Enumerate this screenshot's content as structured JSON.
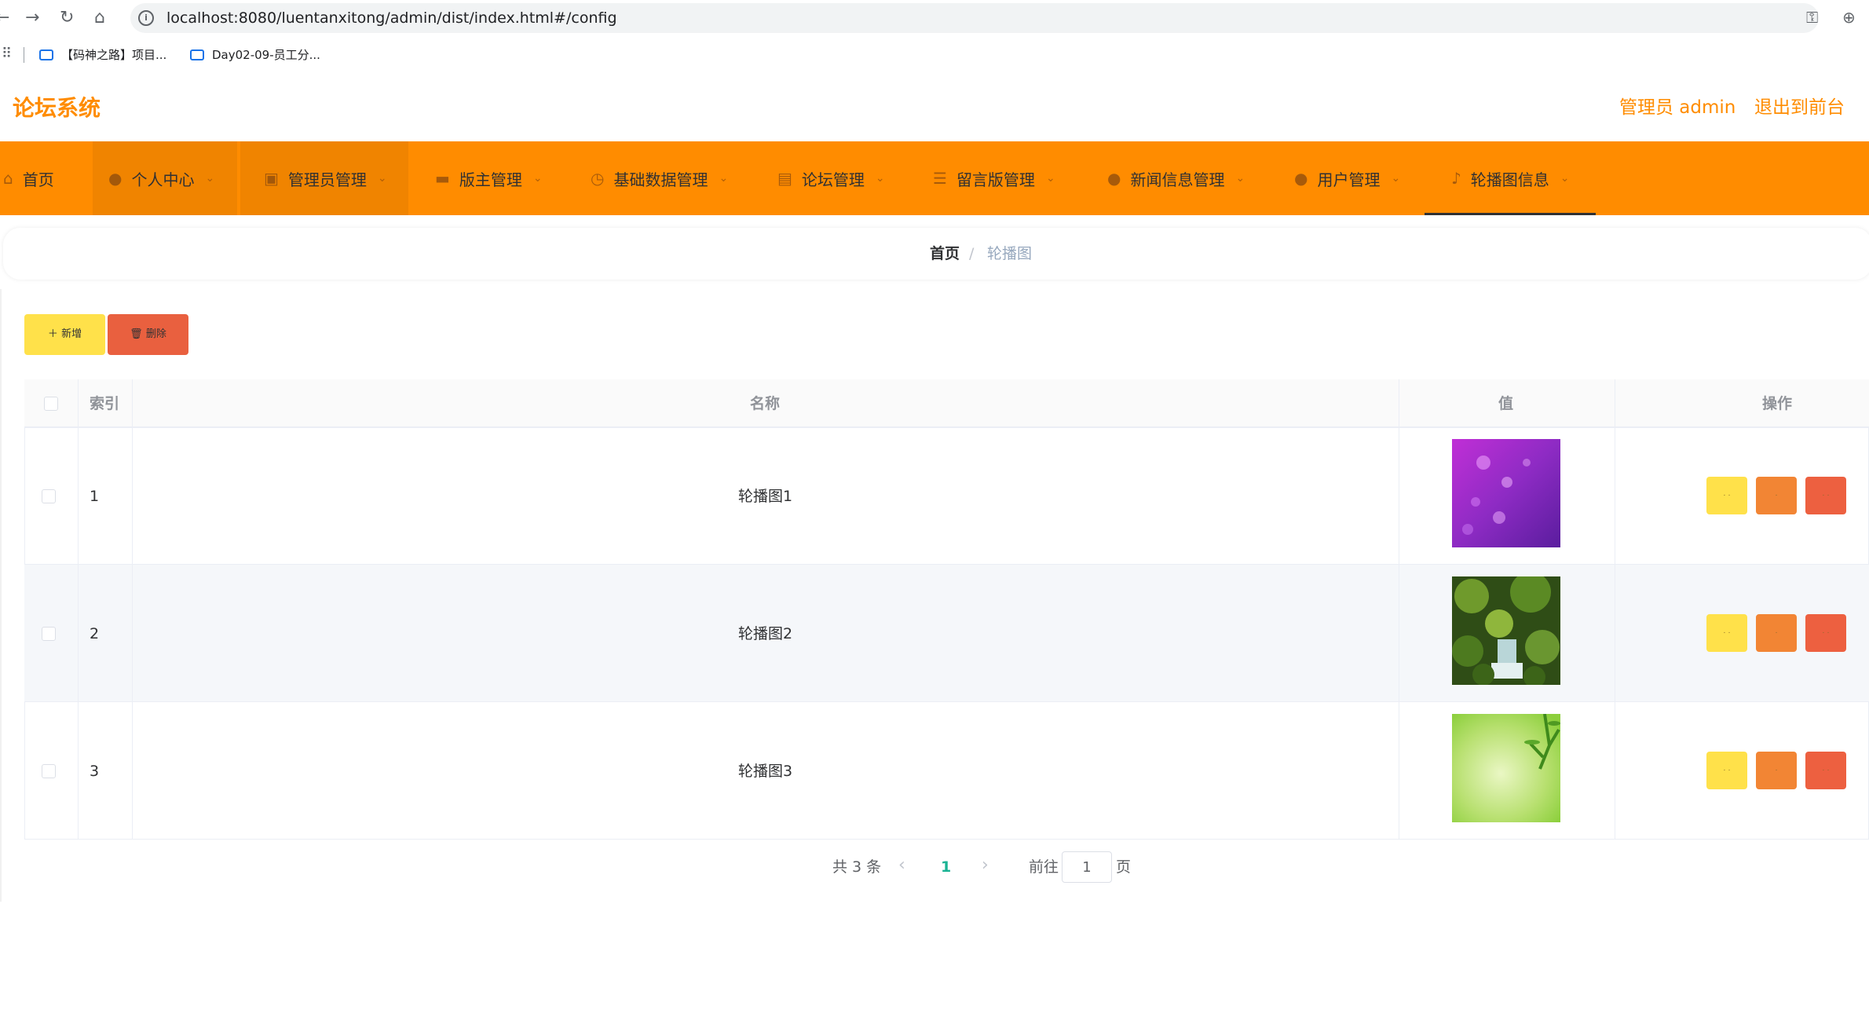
{
  "browser": {
    "url": "localhost:8080/luentanxitong/admin/dist/index.html#/config",
    "bookmarks": [
      "【码神之路】项目...",
      "Day02-09-员工分..."
    ]
  },
  "header": {
    "title": "论坛系统",
    "user_label": "管理员 admin",
    "logout_label": "退出到前台"
  },
  "nav": {
    "items": [
      {
        "label": "首页",
        "icon": "home-icon"
      },
      {
        "label": "个人中心",
        "icon": "user-icon"
      },
      {
        "label": "管理员管理",
        "icon": "briefcase-icon"
      },
      {
        "label": "版主管理",
        "icon": "monitor-icon"
      },
      {
        "label": "基础数据管理",
        "icon": "clock-icon"
      },
      {
        "label": "论坛管理",
        "icon": "document-icon"
      },
      {
        "label": "留言版管理",
        "icon": "sliders-icon"
      },
      {
        "label": "新闻信息管理",
        "icon": "user-icon"
      },
      {
        "label": "用户管理",
        "icon": "user-icon"
      },
      {
        "label": "轮播图信息",
        "icon": "microphone-icon"
      }
    ],
    "active": "轮播图信息"
  },
  "breadcrumb": {
    "home": "首页",
    "separator": "/",
    "current": "轮播图"
  },
  "toolbar": {
    "add_label": "新增",
    "delete_label": "删除"
  },
  "table": {
    "columns": [
      "索引",
      "名称",
      "值",
      "操作"
    ],
    "rows": [
      {
        "index": "1",
        "name": "轮播图1",
        "image": "purple-bokeh"
      },
      {
        "index": "2",
        "name": "轮播图2",
        "image": "forest-waterfall"
      },
      {
        "index": "3",
        "name": "轮播图3",
        "image": "green-leaves"
      }
    ]
  },
  "pagination": {
    "total_label": "共 3 条",
    "current_page": "1",
    "goto_label": "前往",
    "goto_value": "1",
    "page_suffix": "页"
  },
  "colors": {
    "accent": "#ff8c00",
    "add_button": "#ffe14a",
    "delete_button": "#e9603f",
    "edit_button": "#f28534",
    "pager_active": "#1ab394"
  }
}
